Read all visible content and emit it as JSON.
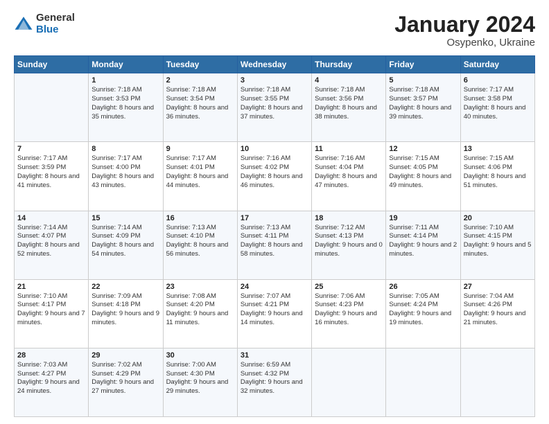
{
  "header": {
    "logo_general": "General",
    "logo_blue": "Blue",
    "title": "January 2024",
    "location": "Osypenko, Ukraine"
  },
  "calendar": {
    "days_of_week": [
      "Sunday",
      "Monday",
      "Tuesday",
      "Wednesday",
      "Thursday",
      "Friday",
      "Saturday"
    ],
    "weeks": [
      [
        {
          "day": "",
          "sunrise": "",
          "sunset": "",
          "daylight": ""
        },
        {
          "day": "1",
          "sunrise": "Sunrise: 7:18 AM",
          "sunset": "Sunset: 3:53 PM",
          "daylight": "Daylight: 8 hours and 35 minutes."
        },
        {
          "day": "2",
          "sunrise": "Sunrise: 7:18 AM",
          "sunset": "Sunset: 3:54 PM",
          "daylight": "Daylight: 8 hours and 36 minutes."
        },
        {
          "day": "3",
          "sunrise": "Sunrise: 7:18 AM",
          "sunset": "Sunset: 3:55 PM",
          "daylight": "Daylight: 8 hours and 37 minutes."
        },
        {
          "day": "4",
          "sunrise": "Sunrise: 7:18 AM",
          "sunset": "Sunset: 3:56 PM",
          "daylight": "Daylight: 8 hours and 38 minutes."
        },
        {
          "day": "5",
          "sunrise": "Sunrise: 7:18 AM",
          "sunset": "Sunset: 3:57 PM",
          "daylight": "Daylight: 8 hours and 39 minutes."
        },
        {
          "day": "6",
          "sunrise": "Sunrise: 7:17 AM",
          "sunset": "Sunset: 3:58 PM",
          "daylight": "Daylight: 8 hours and 40 minutes."
        }
      ],
      [
        {
          "day": "7",
          "sunrise": "Sunrise: 7:17 AM",
          "sunset": "Sunset: 3:59 PM",
          "daylight": "Daylight: 8 hours and 41 minutes."
        },
        {
          "day": "8",
          "sunrise": "Sunrise: 7:17 AM",
          "sunset": "Sunset: 4:00 PM",
          "daylight": "Daylight: 8 hours and 43 minutes."
        },
        {
          "day": "9",
          "sunrise": "Sunrise: 7:17 AM",
          "sunset": "Sunset: 4:01 PM",
          "daylight": "Daylight: 8 hours and 44 minutes."
        },
        {
          "day": "10",
          "sunrise": "Sunrise: 7:16 AM",
          "sunset": "Sunset: 4:02 PM",
          "daylight": "Daylight: 8 hours and 46 minutes."
        },
        {
          "day": "11",
          "sunrise": "Sunrise: 7:16 AM",
          "sunset": "Sunset: 4:04 PM",
          "daylight": "Daylight: 8 hours and 47 minutes."
        },
        {
          "day": "12",
          "sunrise": "Sunrise: 7:15 AM",
          "sunset": "Sunset: 4:05 PM",
          "daylight": "Daylight: 8 hours and 49 minutes."
        },
        {
          "day": "13",
          "sunrise": "Sunrise: 7:15 AM",
          "sunset": "Sunset: 4:06 PM",
          "daylight": "Daylight: 8 hours and 51 minutes."
        }
      ],
      [
        {
          "day": "14",
          "sunrise": "Sunrise: 7:14 AM",
          "sunset": "Sunset: 4:07 PM",
          "daylight": "Daylight: 8 hours and 52 minutes."
        },
        {
          "day": "15",
          "sunrise": "Sunrise: 7:14 AM",
          "sunset": "Sunset: 4:09 PM",
          "daylight": "Daylight: 8 hours and 54 minutes."
        },
        {
          "day": "16",
          "sunrise": "Sunrise: 7:13 AM",
          "sunset": "Sunset: 4:10 PM",
          "daylight": "Daylight: 8 hours and 56 minutes."
        },
        {
          "day": "17",
          "sunrise": "Sunrise: 7:13 AM",
          "sunset": "Sunset: 4:11 PM",
          "daylight": "Daylight: 8 hours and 58 minutes."
        },
        {
          "day": "18",
          "sunrise": "Sunrise: 7:12 AM",
          "sunset": "Sunset: 4:13 PM",
          "daylight": "Daylight: 9 hours and 0 minutes."
        },
        {
          "day": "19",
          "sunrise": "Sunrise: 7:11 AM",
          "sunset": "Sunset: 4:14 PM",
          "daylight": "Daylight: 9 hours and 2 minutes."
        },
        {
          "day": "20",
          "sunrise": "Sunrise: 7:10 AM",
          "sunset": "Sunset: 4:15 PM",
          "daylight": "Daylight: 9 hours and 5 minutes."
        }
      ],
      [
        {
          "day": "21",
          "sunrise": "Sunrise: 7:10 AM",
          "sunset": "Sunset: 4:17 PM",
          "daylight": "Daylight: 9 hours and 7 minutes."
        },
        {
          "day": "22",
          "sunrise": "Sunrise: 7:09 AM",
          "sunset": "Sunset: 4:18 PM",
          "daylight": "Daylight: 9 hours and 9 minutes."
        },
        {
          "day": "23",
          "sunrise": "Sunrise: 7:08 AM",
          "sunset": "Sunset: 4:20 PM",
          "daylight": "Daylight: 9 hours and 11 minutes."
        },
        {
          "day": "24",
          "sunrise": "Sunrise: 7:07 AM",
          "sunset": "Sunset: 4:21 PM",
          "daylight": "Daylight: 9 hours and 14 minutes."
        },
        {
          "day": "25",
          "sunrise": "Sunrise: 7:06 AM",
          "sunset": "Sunset: 4:23 PM",
          "daylight": "Daylight: 9 hours and 16 minutes."
        },
        {
          "day": "26",
          "sunrise": "Sunrise: 7:05 AM",
          "sunset": "Sunset: 4:24 PM",
          "daylight": "Daylight: 9 hours and 19 minutes."
        },
        {
          "day": "27",
          "sunrise": "Sunrise: 7:04 AM",
          "sunset": "Sunset: 4:26 PM",
          "daylight": "Daylight: 9 hours and 21 minutes."
        }
      ],
      [
        {
          "day": "28",
          "sunrise": "Sunrise: 7:03 AM",
          "sunset": "Sunset: 4:27 PM",
          "daylight": "Daylight: 9 hours and 24 minutes."
        },
        {
          "day": "29",
          "sunrise": "Sunrise: 7:02 AM",
          "sunset": "Sunset: 4:29 PM",
          "daylight": "Daylight: 9 hours and 27 minutes."
        },
        {
          "day": "30",
          "sunrise": "Sunrise: 7:00 AM",
          "sunset": "Sunset: 4:30 PM",
          "daylight": "Daylight: 9 hours and 29 minutes."
        },
        {
          "day": "31",
          "sunrise": "Sunrise: 6:59 AM",
          "sunset": "Sunset: 4:32 PM",
          "daylight": "Daylight: 9 hours and 32 minutes."
        },
        {
          "day": "",
          "sunrise": "",
          "sunset": "",
          "daylight": ""
        },
        {
          "day": "",
          "sunrise": "",
          "sunset": "",
          "daylight": ""
        },
        {
          "day": "",
          "sunrise": "",
          "sunset": "",
          "daylight": ""
        }
      ]
    ]
  }
}
